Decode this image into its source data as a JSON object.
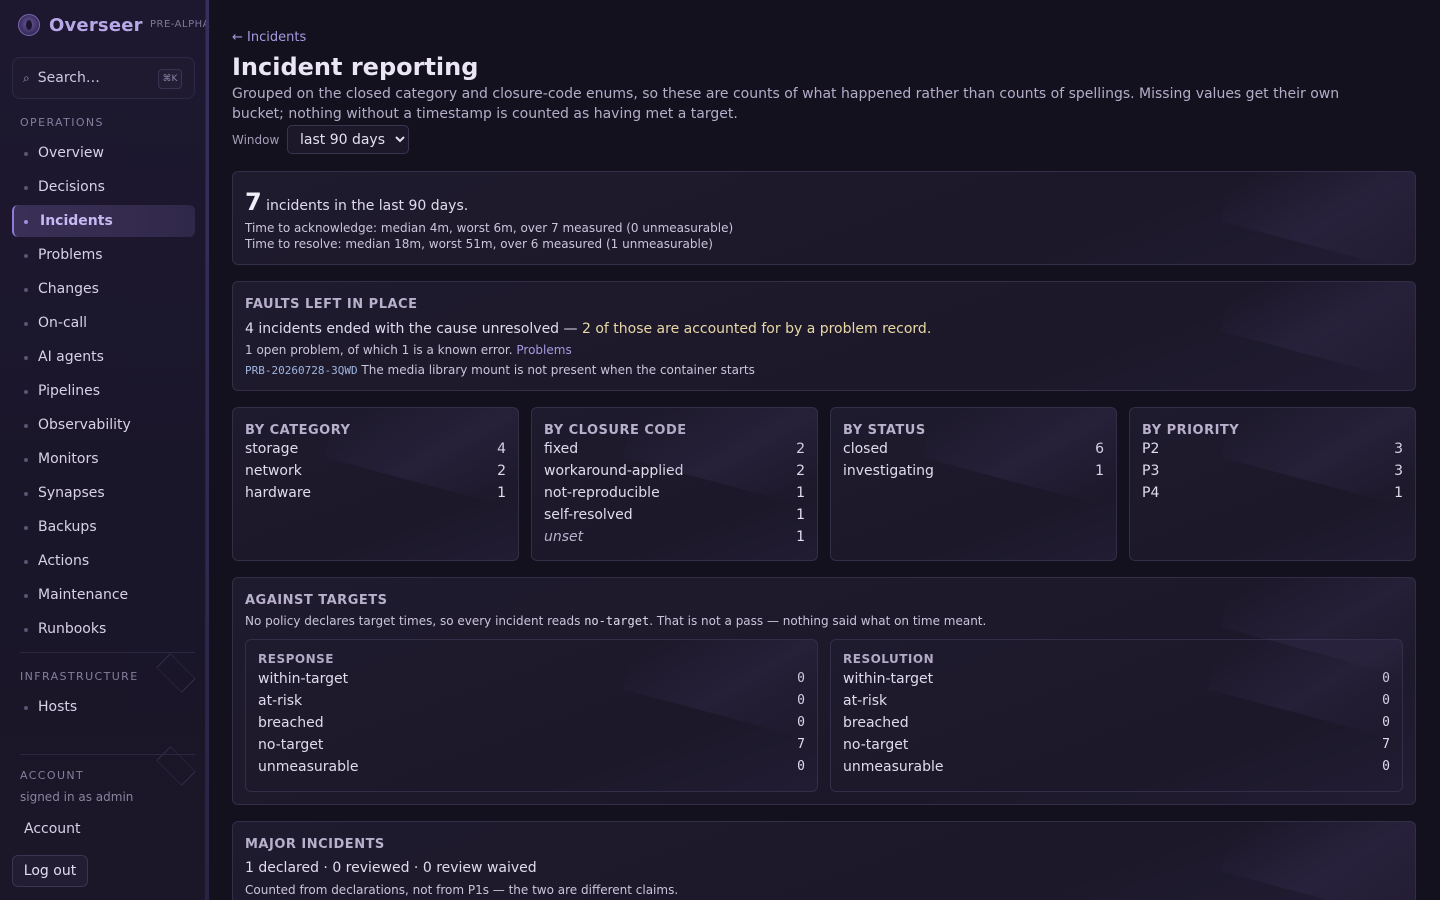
{
  "sidebar": {
    "brand": "Overseer",
    "tag": "PRE-ALPHA",
    "search_placeholder": "Search…",
    "search_shortcut": "⌘K",
    "sections": {
      "operations": "OPERATIONS",
      "infrastructure": "INFRASTRUCTURE",
      "account": "ACCOUNT"
    },
    "items": [
      {
        "label": "Overview"
      },
      {
        "label": "Decisions"
      },
      {
        "label": "Incidents"
      },
      {
        "label": "Problems"
      },
      {
        "label": "Changes"
      },
      {
        "label": "On-call"
      },
      {
        "label": "AI agents"
      },
      {
        "label": "Pipelines"
      },
      {
        "label": "Observability"
      },
      {
        "label": "Monitors"
      },
      {
        "label": "Synapses"
      },
      {
        "label": "Backups"
      },
      {
        "label": "Actions"
      },
      {
        "label": "Maintenance"
      },
      {
        "label": "Runbooks"
      }
    ],
    "infra_items": [
      {
        "label": "Hosts"
      }
    ],
    "signed_in": "signed in as admin",
    "account_label": "Account",
    "logout_label": "Log out"
  },
  "main": {
    "back_link": "← Incidents",
    "title": "Incident reporting",
    "description": "Grouped on the closed category and closure-code enums, so these are counts of what happened rather than counts of spellings. Missing values get their own bucket; nothing without a timestamp is counted as having met a target.",
    "window_label": "Window",
    "window_value": "last 90 days",
    "summary": {
      "count": "7",
      "count_text": "incidents in the last 90 days.",
      "ack": "Time to acknowledge: median 4m, worst 6m, over 7 measured (0 unmeasurable)",
      "resolve": "Time to resolve: median 18m, worst 51m, over 6 measured (1 unmeasurable)"
    },
    "faults": {
      "title": "FAULTS LEFT IN PLACE",
      "line_start": "4 incidents ended with the cause unresolved — ",
      "line_highlight": "2 of those are accounted for by a problem record.",
      "open_line": "1 open problem, of which 1 is a known error.",
      "problems_link": "Problems",
      "problem_id": "PRB-20260728-3QWD",
      "problem_text": "The media library mount is not present when the container starts"
    },
    "breakdowns": [
      {
        "title": "BY CATEGORY",
        "rows": [
          {
            "label": "storage",
            "value": "4"
          },
          {
            "label": "network",
            "value": "2"
          },
          {
            "label": "hardware",
            "value": "1"
          }
        ]
      },
      {
        "title": "BY CLOSURE CODE",
        "rows": [
          {
            "label": "fixed",
            "value": "2"
          },
          {
            "label": "workaround-applied",
            "value": "2"
          },
          {
            "label": "not-reproducible",
            "value": "1"
          },
          {
            "label": "self-resolved",
            "value": "1"
          },
          {
            "label": "unset",
            "value": "1"
          }
        ]
      },
      {
        "title": "BY STATUS",
        "rows": [
          {
            "label": "closed",
            "value": "6"
          },
          {
            "label": "investigating",
            "value": "1"
          }
        ]
      },
      {
        "title": "BY PRIORITY",
        "rows": [
          {
            "label": "P2",
            "value": "3"
          },
          {
            "label": "P3",
            "value": "3"
          },
          {
            "label": "P4",
            "value": "1"
          }
        ]
      }
    ],
    "targets": {
      "title": "AGAINST TARGETS",
      "desc_start": "No policy declares target times, so every incident reads ",
      "desc_code": "no-target",
      "desc_end": ". That is not a pass — nothing said what on time meant.",
      "response": {
        "title": "RESPONSE",
        "rows": [
          {
            "label": "within-target",
            "value": "0"
          },
          {
            "label": "at-risk",
            "value": "0"
          },
          {
            "label": "breached",
            "value": "0"
          },
          {
            "label": "no-target",
            "value": "7"
          },
          {
            "label": "unmeasurable",
            "value": "0"
          }
        ]
      },
      "resolution": {
        "title": "RESOLUTION",
        "rows": [
          {
            "label": "within-target",
            "value": "0"
          },
          {
            "label": "at-risk",
            "value": "0"
          },
          {
            "label": "breached",
            "value": "0"
          },
          {
            "label": "no-target",
            "value": "7"
          },
          {
            "label": "unmeasurable",
            "value": "0"
          }
        ]
      }
    },
    "major": {
      "title": "MAJOR INCIDENTS",
      "line": "1 declared · 0 reviewed · 0 review waived",
      "note": "Counted from declarations, not from P1s — the two are different claims."
    }
  }
}
